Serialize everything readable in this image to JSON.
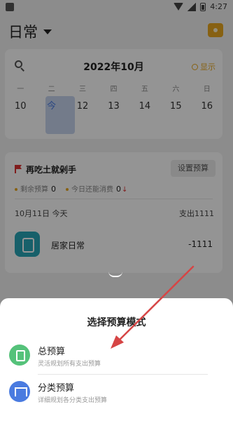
{
  "status_bar": {
    "time": "4:27"
  },
  "header": {
    "book_title": "日常"
  },
  "calendar": {
    "month_title": "2022年10月",
    "show_label": "显示",
    "weekdays": [
      "一",
      "二",
      "三",
      "四",
      "五",
      "六",
      "日"
    ],
    "days": [
      "10",
      "今",
      "12",
      "13",
      "14",
      "15",
      "16"
    ],
    "selected_day_index": 1
  },
  "budget_card": {
    "title": "再吃土就剁手",
    "set_budget_label": "设置预算",
    "remaining_label": "剩余预算",
    "remaining_value": "0",
    "today_label": "今日还能消费",
    "today_value": "0",
    "day_date": "10月11日 今天",
    "day_expense": "支出1111",
    "record": {
      "name": "居家日常",
      "amount": "-1111"
    }
  },
  "sheet": {
    "title": "选择预算模式",
    "options": [
      {
        "label": "总预算",
        "desc": "灵活规划所有支出预算"
      },
      {
        "label": "分类预算",
        "desc": "详细规划各分类支出预算"
      }
    ]
  },
  "colors": {
    "accent_orange": "#e8a820",
    "highlight_blue": "#4a7be0",
    "green_icon": "#55c27a",
    "teal_icon": "#28a6b7",
    "arrow_red": "#d64545"
  }
}
